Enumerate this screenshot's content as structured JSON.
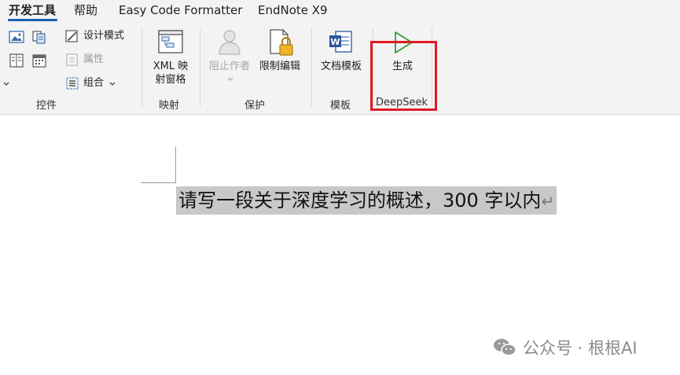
{
  "tabs": [
    {
      "label": "开发工具",
      "active": true
    },
    {
      "label": "帮助"
    },
    {
      "label": "Easy Code Formatter"
    },
    {
      "label": "EndNote X9"
    }
  ],
  "ribbon": {
    "controls": {
      "design_mode": "设计模式",
      "properties": "属性",
      "group": "组合",
      "group_label": "控件"
    },
    "mapping": {
      "xml_line1": "XML 映",
      "xml_line2": "射窗格",
      "group_label": "映射"
    },
    "protect": {
      "block_authors": "阻止作者",
      "restrict_editing": "限制编辑",
      "group_label": "保护"
    },
    "templates": {
      "document_template": "文档模板",
      "group_label": "模板"
    },
    "deepseek": {
      "generate": "生成",
      "group_label": "DeepSeek"
    }
  },
  "document": {
    "text": "请写一段关于深度学习的概述，300 字以内",
    "paragraph_mark": "↵"
  },
  "watermark": {
    "text": "公众号 · 根根AI"
  },
  "colors": {
    "highlight": "#e01b24",
    "accent": "#1a5fb4",
    "play": "#3c9a3c"
  }
}
